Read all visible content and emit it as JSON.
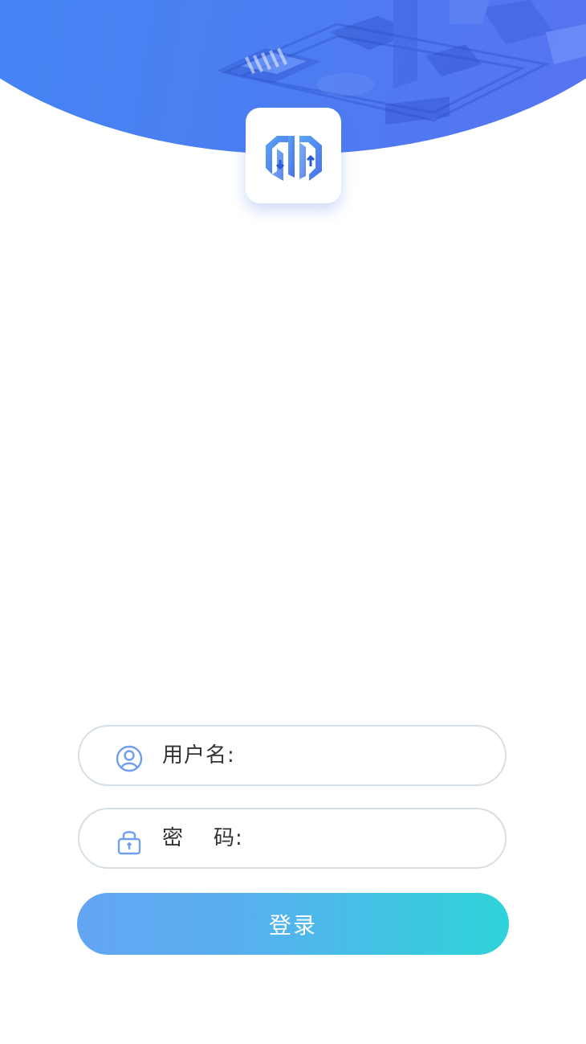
{
  "colors": {
    "header": "#4a7ff2",
    "logo_blue": "#4f7ff0",
    "icon_blue": "#6f9ef2",
    "button_start": "#63a5f3",
    "button_end": "#2ed3d9",
    "field_border": "#d6dee6"
  },
  "header": {
    "illustration": "isometric-tech-illustration",
    "logo_icon": "app-logo-arrows-icon"
  },
  "form": {
    "username": {
      "icon": "user-icon",
      "label": "用户名:",
      "value": ""
    },
    "password": {
      "icon": "lock-icon",
      "label": "密    码:",
      "value": ""
    },
    "login_label": "登录"
  }
}
